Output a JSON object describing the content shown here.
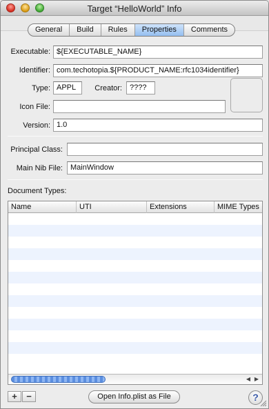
{
  "window": {
    "title": "Target “HelloWorld” Info"
  },
  "tabs": [
    {
      "label": "General"
    },
    {
      "label": "Build"
    },
    {
      "label": "Rules"
    },
    {
      "label": "Properties",
      "selected": true
    },
    {
      "label": "Comments"
    }
  ],
  "properties": {
    "executable": {
      "label": "Executable:",
      "value": "${EXECUTABLE_NAME}"
    },
    "identifier": {
      "label": "Identifier:",
      "value": "com.techotopia.${PRODUCT_NAME:rfc1034identifier}"
    },
    "type": {
      "label": "Type:",
      "value": "APPL"
    },
    "creator": {
      "label": "Creator:",
      "value": "????"
    },
    "icon_file": {
      "label": "Icon File:",
      "value": ""
    },
    "version": {
      "label": "Version:",
      "value": "1.0"
    },
    "principal_class": {
      "label": "Principal Class:",
      "value": ""
    },
    "main_nib_file": {
      "label": "Main Nib File:",
      "value": "MainWindow"
    }
  },
  "document_types": {
    "label": "Document Types:",
    "columns": [
      "Name",
      "UTI",
      "Extensions",
      "MIME Types"
    ],
    "row_count": 13
  },
  "footer": {
    "add_label": "+",
    "remove_label": "−",
    "open_plist_label": "Open Info.plist as File",
    "help_label": "?"
  },
  "colors": {
    "selected_tab": "#94bff0",
    "scroll_thumb": "#5c8fe0",
    "alt_row": "#edf3fe"
  }
}
